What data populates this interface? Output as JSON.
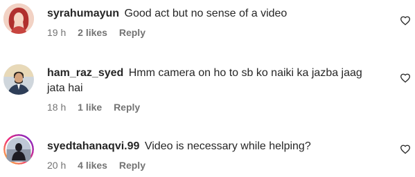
{
  "comments": [
    {
      "username": "syrahumayun",
      "text": "Good act but no sense of a video",
      "time": "19 h",
      "likes": "2 likes",
      "reply": "Reply",
      "avatar_icon": "profile-photo-red-hair",
      "has_story_ring": false
    },
    {
      "username": "ham_raz_syed",
      "text": "Hmm camera on ho to sb ko naiki ka jazba jaag jata hai",
      "time": "18 h",
      "likes": "1 like",
      "reply": "Reply",
      "avatar_icon": "profile-photo-man-suit",
      "has_story_ring": false
    },
    {
      "username": "syedtahanaqvi.99",
      "text": "Video is necessary while helping?",
      "time": "20 h",
      "likes": "4 likes",
      "reply": "Reply",
      "avatar_icon": "profile-photo-story-ring",
      "has_story_ring": true
    }
  ],
  "colors": {
    "text": "#262626",
    "meta": "#737373",
    "ring_start": "#f9ce34",
    "ring_mid": "#ee2a7b",
    "ring_end": "#6228d7"
  },
  "icons": {
    "like": "heart-outline-icon"
  }
}
